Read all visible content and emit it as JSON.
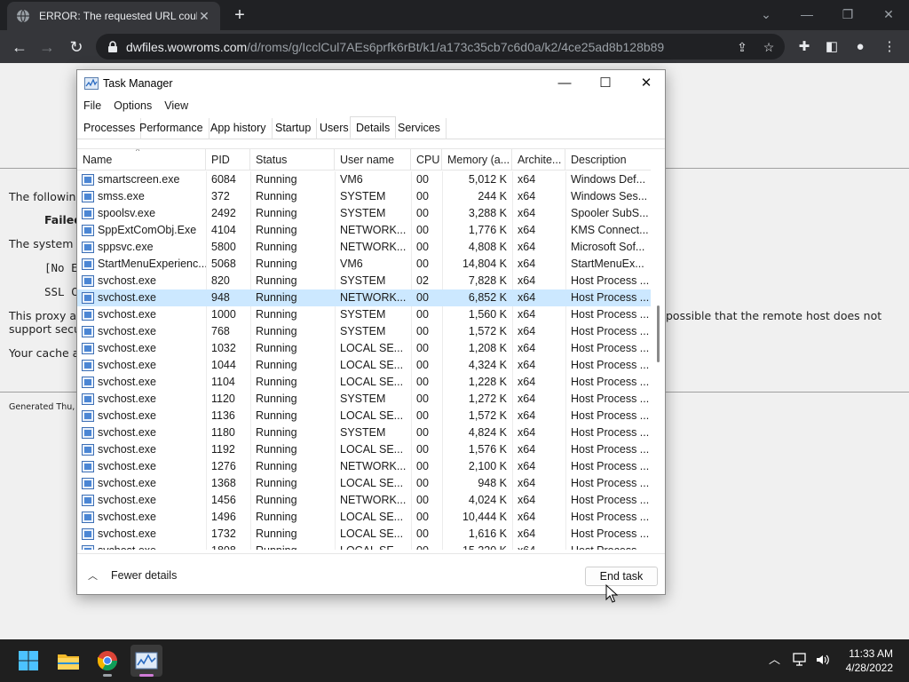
{
  "browser": {
    "tab_title": "ERROR: The requested URL could",
    "tab_close": "✕",
    "new_tab": "+",
    "url_host": "dwfiles.wowroms.com",
    "url_path": "/d/roms/g/IcclCul7AEs6prfk6rBt/k1/a173c35cb7c6d0a/k2/4ce25ad8b128b89",
    "window_controls": [
      "⌄",
      "—",
      "❐",
      "✕"
    ]
  },
  "webpage": {
    "line1": "The following",
    "line2": "Failed",
    "line3": "The system",
    "line4": "[No E",
    "line5": "SSL C",
    "line6a": "This proxy a",
    "line6b": "possible that the remote host does not",
    "line7": "support secu",
    "line8": "Your cache a",
    "footer": "Generated Thu,"
  },
  "task_manager": {
    "title": "Task Manager",
    "menu": [
      "File",
      "Options",
      "View"
    ],
    "tabs": [
      "Processes",
      "Performance",
      "App history",
      "Startup",
      "Users",
      "Details",
      "Services"
    ],
    "active_tab": "Details",
    "columns": [
      "Name",
      "PID",
      "Status",
      "User name",
      "CPU",
      "Memory (a...",
      "Archite...",
      "Description"
    ],
    "rows": [
      {
        "name": "smartscreen.exe",
        "pid": "6084",
        "status": "Running",
        "user": "VM6",
        "cpu": "00",
        "mem": "5,012 K",
        "arch": "x64",
        "desc": "Windows Def..."
      },
      {
        "name": "smss.exe",
        "pid": "372",
        "status": "Running",
        "user": "SYSTEM",
        "cpu": "00",
        "mem": "244 K",
        "arch": "x64",
        "desc": "Windows Ses..."
      },
      {
        "name": "spoolsv.exe",
        "pid": "2492",
        "status": "Running",
        "user": "SYSTEM",
        "cpu": "00",
        "mem": "3,288 K",
        "arch": "x64",
        "desc": "Spooler SubS..."
      },
      {
        "name": "SppExtComObj.Exe",
        "pid": "4104",
        "status": "Running",
        "user": "NETWORK...",
        "cpu": "00",
        "mem": "1,776 K",
        "arch": "x64",
        "desc": "KMS Connect..."
      },
      {
        "name": "sppsvc.exe",
        "pid": "5800",
        "status": "Running",
        "user": "NETWORK...",
        "cpu": "00",
        "mem": "4,808 K",
        "arch": "x64",
        "desc": "Microsoft Sof..."
      },
      {
        "name": "StartMenuExperienc...",
        "pid": "5068",
        "status": "Running",
        "user": "VM6",
        "cpu": "00",
        "mem": "14,804 K",
        "arch": "x64",
        "desc": "StartMenuEx..."
      },
      {
        "name": "svchost.exe",
        "pid": "820",
        "status": "Running",
        "user": "SYSTEM",
        "cpu": "02",
        "mem": "7,828 K",
        "arch": "x64",
        "desc": "Host Process ..."
      },
      {
        "name": "svchost.exe",
        "pid": "948",
        "status": "Running",
        "user": "NETWORK...",
        "cpu": "00",
        "mem": "6,852 K",
        "arch": "x64",
        "desc": "Host Process ...",
        "selected": true
      },
      {
        "name": "svchost.exe",
        "pid": "1000",
        "status": "Running",
        "user": "SYSTEM",
        "cpu": "00",
        "mem": "1,560 K",
        "arch": "x64",
        "desc": "Host Process ..."
      },
      {
        "name": "svchost.exe",
        "pid": "768",
        "status": "Running",
        "user": "SYSTEM",
        "cpu": "00",
        "mem": "1,572 K",
        "arch": "x64",
        "desc": "Host Process ..."
      },
      {
        "name": "svchost.exe",
        "pid": "1032",
        "status": "Running",
        "user": "LOCAL SE...",
        "cpu": "00",
        "mem": "1,208 K",
        "arch": "x64",
        "desc": "Host Process ..."
      },
      {
        "name": "svchost.exe",
        "pid": "1044",
        "status": "Running",
        "user": "LOCAL SE...",
        "cpu": "00",
        "mem": "4,324 K",
        "arch": "x64",
        "desc": "Host Process ..."
      },
      {
        "name": "svchost.exe",
        "pid": "1104",
        "status": "Running",
        "user": "LOCAL SE...",
        "cpu": "00",
        "mem": "1,228 K",
        "arch": "x64",
        "desc": "Host Process ..."
      },
      {
        "name": "svchost.exe",
        "pid": "1120",
        "status": "Running",
        "user": "SYSTEM",
        "cpu": "00",
        "mem": "1,272 K",
        "arch": "x64",
        "desc": "Host Process ..."
      },
      {
        "name": "svchost.exe",
        "pid": "1136",
        "status": "Running",
        "user": "LOCAL SE...",
        "cpu": "00",
        "mem": "1,572 K",
        "arch": "x64",
        "desc": "Host Process ..."
      },
      {
        "name": "svchost.exe",
        "pid": "1180",
        "status": "Running",
        "user": "SYSTEM",
        "cpu": "00",
        "mem": "4,824 K",
        "arch": "x64",
        "desc": "Host Process ..."
      },
      {
        "name": "svchost.exe",
        "pid": "1192",
        "status": "Running",
        "user": "LOCAL SE...",
        "cpu": "00",
        "mem": "1,576 K",
        "arch": "x64",
        "desc": "Host Process ..."
      },
      {
        "name": "svchost.exe",
        "pid": "1276",
        "status": "Running",
        "user": "NETWORK...",
        "cpu": "00",
        "mem": "2,100 K",
        "arch": "x64",
        "desc": "Host Process ..."
      },
      {
        "name": "svchost.exe",
        "pid": "1368",
        "status": "Running",
        "user": "LOCAL SE...",
        "cpu": "00",
        "mem": "948 K",
        "arch": "x64",
        "desc": "Host Process ..."
      },
      {
        "name": "svchost.exe",
        "pid": "1456",
        "status": "Running",
        "user": "NETWORK...",
        "cpu": "00",
        "mem": "4,024 K",
        "arch": "x64",
        "desc": "Host Process ..."
      },
      {
        "name": "svchost.exe",
        "pid": "1496",
        "status": "Running",
        "user": "LOCAL SE...",
        "cpu": "00",
        "mem": "10,444 K",
        "arch": "x64",
        "desc": "Host Process ..."
      },
      {
        "name": "svchost.exe",
        "pid": "1732",
        "status": "Running",
        "user": "LOCAL SE...",
        "cpu": "00",
        "mem": "1,616 K",
        "arch": "x64",
        "desc": "Host Process ..."
      },
      {
        "name": "svchost.exe",
        "pid": "1808",
        "status": "Running",
        "user": "LOCAL SE...",
        "cpu": "00",
        "mem": "15,320 K",
        "arch": "x64",
        "desc": "Host Process ..."
      }
    ],
    "fewer_details": "Fewer details",
    "end_task": "End task",
    "window_controls": [
      "—",
      "☐",
      "✕"
    ]
  },
  "taskbar": {
    "time": "11:33 AM",
    "date": "4/28/2022",
    "apps": [
      "start-icon",
      "file-explorer-icon",
      "chrome-icon",
      "task-manager-icon"
    ]
  },
  "colors": {
    "selection": "#cce8ff",
    "chrome_dark": "#202124",
    "taskbar": "#1f1f1f",
    "task_manager_accent": "#d07bd6"
  }
}
